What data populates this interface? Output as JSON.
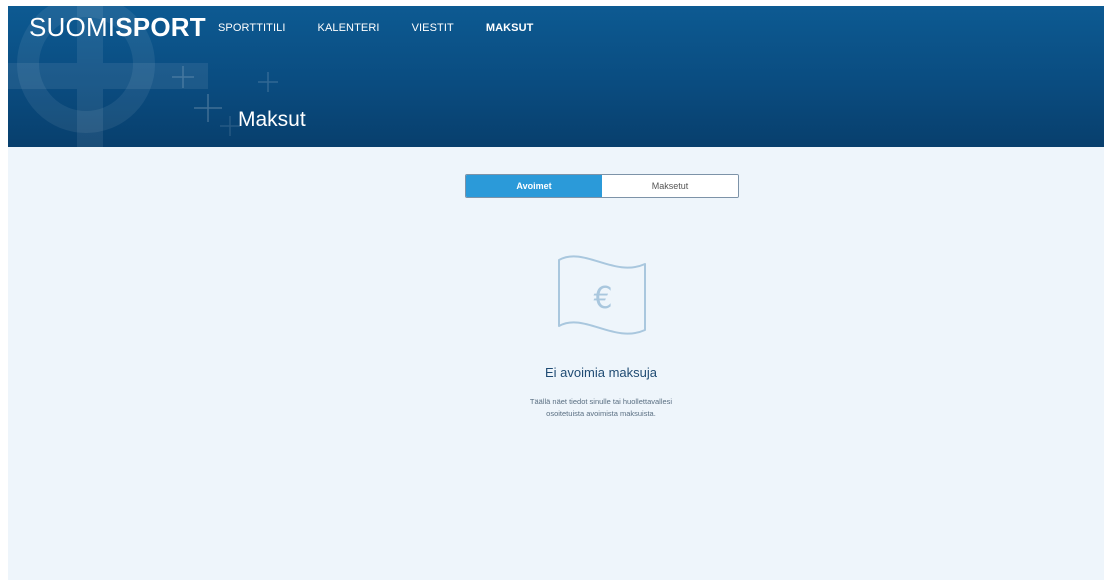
{
  "header": {
    "logo_light": "SUOMI",
    "logo_bold": "SPORT",
    "nav": [
      {
        "label": "SPORTTITILI",
        "active": false
      },
      {
        "label": "KALENTERI",
        "active": false
      },
      {
        "label": "VIESTIT",
        "active": false
      },
      {
        "label": "MAKSUT",
        "active": true
      }
    ],
    "page_title": "Maksut"
  },
  "tabs": [
    {
      "label": "Avoimet",
      "active": true
    },
    {
      "label": "Maksetut",
      "active": false
    }
  ],
  "empty_state": {
    "icon": "euro-banknote-icon",
    "title": "Ei avoimia maksuja",
    "description_line1": "Täällä näet tiedot sinulle tai huollettavallesi",
    "description_line2": "osoitetuista avoimista maksuista."
  },
  "colors": {
    "header_blue": "#0a4c80",
    "tab_active": "#2b9ad9",
    "page_background": "#eef5fb",
    "empty_title": "#1f4b73"
  }
}
